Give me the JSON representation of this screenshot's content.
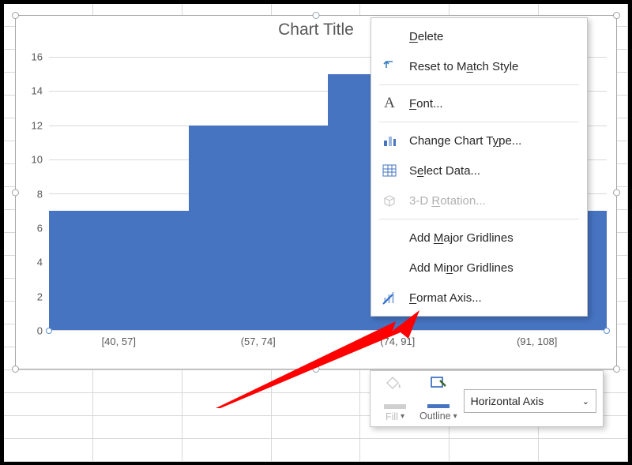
{
  "chart": {
    "title": "Chart Title",
    "x_labels": [
      "[40, 57]",
      "(57, 74]",
      "(74, 91]",
      "(91, 108]"
    ],
    "fill_color": "#4674c1"
  },
  "chart_data": {
    "type": "bar",
    "categories": [
      "[40, 57]",
      "(57, 74]",
      "(74, 91]",
      "(91, 108]"
    ],
    "values": [
      7,
      12,
      15,
      7
    ],
    "title": "Chart Title",
    "xlabel": "",
    "ylabel": "",
    "ylim": [
      0,
      16
    ],
    "y_ticks": [
      0,
      2,
      4,
      6,
      8,
      10,
      12,
      14,
      16
    ]
  },
  "context_menu": {
    "delete": "Delete",
    "reset": "Reset to Match Style",
    "font": "Font...",
    "change_type": "Change Chart Type...",
    "select_data": "Select Data...",
    "rotation": "3-D Rotation...",
    "add_major": "Add Major Gridlines",
    "add_minor": "Add Minor Gridlines",
    "format_axis": "Format Axis..."
  },
  "mini_toolbar": {
    "fill": "Fill",
    "outline": "Outline",
    "selector": "Horizontal Axis"
  }
}
